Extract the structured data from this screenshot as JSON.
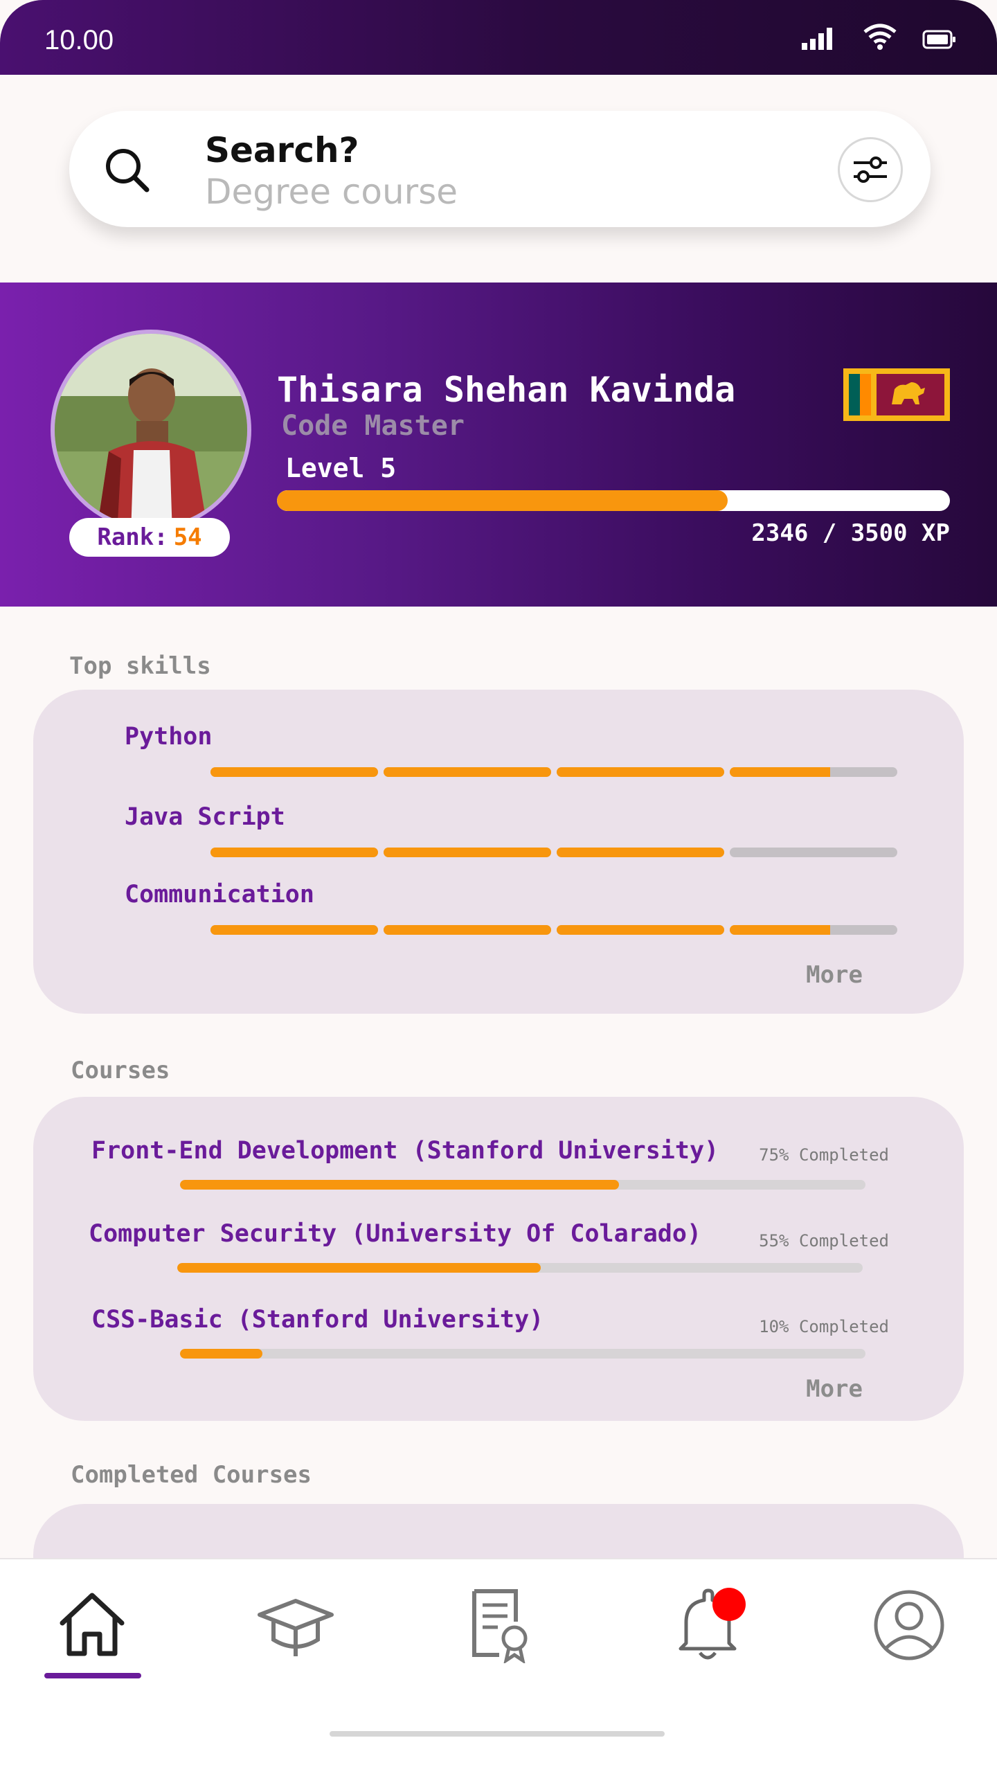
{
  "status_bar": {
    "time": "10.00"
  },
  "search": {
    "title": "Search?",
    "placeholder": "Degree course"
  },
  "profile": {
    "name": "Thisara Shehan Kavinda",
    "title": "Code Master",
    "level": "Level 5",
    "xp_text": "2346 / 3500 XP",
    "xp_current": 2346,
    "xp_max": 3500,
    "rank_label": "Rank:",
    "rank_value": "54",
    "flag": "sri-lanka-flag"
  },
  "skills": {
    "heading": "Top skills",
    "items": [
      {
        "label": "Python",
        "level": 0.9
      },
      {
        "label": "Java Script",
        "level": 0.75
      },
      {
        "label": "Communication",
        "level": 0.9
      }
    ],
    "more": "More"
  },
  "courses": {
    "heading": "Courses",
    "items": [
      {
        "label": "Front-End Development (Stanford University)",
        "pct_text": "75% Completed",
        "progress": 0.64
      },
      {
        "label": "Computer Security (University Of Colarado)",
        "pct_text": "55% Completed",
        "progress": 0.53
      },
      {
        "label": "CSS-Basic (Stanford University)",
        "pct_text": "10% Completed",
        "progress": 0.12
      }
    ],
    "more": "More"
  },
  "completed": {
    "heading": "Completed Courses"
  },
  "nav": {
    "items": [
      "home-icon",
      "graduation-cap-icon",
      "certificate-icon",
      "bell-icon",
      "profile-icon"
    ],
    "active": "home-icon"
  },
  "colors": {
    "accent": "#6a1b9a",
    "progress": "#f8960e",
    "notification": "#ff0000"
  }
}
